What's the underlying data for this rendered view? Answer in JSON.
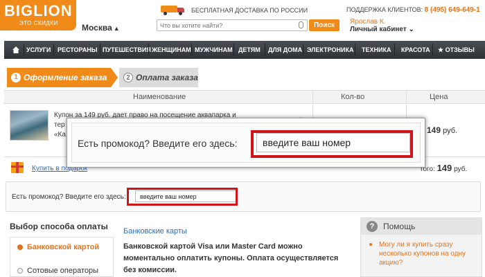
{
  "header": {
    "logo_title": "BIGLION",
    "logo_sub": "ЭТО СКИДКИ",
    "city": "Москва",
    "delivery": "БЕСПЛАТНАЯ ДОСТАВКА ПО РОССИИ",
    "search_placeholder": "Что вы хотите найти?",
    "search_button": "Поиск",
    "support_label": "ПОДДЕРЖКА КЛИЕНТОВ:",
    "support_phone": "8 (495) 649-649-1",
    "user_name": "Ярослав К.",
    "cabinet": "Личный кабинет"
  },
  "nav": {
    "items": [
      "УСЛУГИ",
      "РЕСТОРАНЫ",
      "ПУТЕШЕСТВИЯ",
      "ЖЕНЩИНАМ",
      "МУЖЧИНАМ",
      "ДЕТЯМ",
      "ДЛЯ ДОМА",
      "ЭЛЕКТРОНИКА",
      "ТЕХНИКА",
      "КРАСОТА",
      "ОТЗЫВЫ"
    ]
  },
  "steps": {
    "step1_num": "1",
    "step1_label": "Оформление заказа",
    "step2_num": "2",
    "step2_label": "Оплата заказа"
  },
  "table": {
    "col_name": "Наименование",
    "col_qty": "Кол-во",
    "col_price": "Цена",
    "row": {
      "text_line1": "Купон за 149 руб. дает право на посещение аквапарка и",
      "text_line2": "тер",
      "text_line3": "«Ка",
      "price_value": "149",
      "price_unit": "руб."
    }
  },
  "cart": {
    "buy_gift": "Купить в подарок",
    "total_label": "того:",
    "total_value": "149",
    "total_unit": "руб."
  },
  "promo": {
    "label": "Есть промокод? Введите его здесь:",
    "input_value": "введите ваш номер"
  },
  "payment": {
    "title": "Выбор способа оплаты",
    "option_selected": "Банковской картой",
    "option_other": "Сотовые операторы",
    "bank_cards": "Банковские карты",
    "bank_desc": "Банковской картой Visa или Master Card можно моментально оплатить купоны. Оплата осуществляется без комиссии."
  },
  "help": {
    "icon": "?",
    "title": "Помощь",
    "question": "Могу ли я купить сразу несколько купонов на одну акцию?"
  },
  "colors": {
    "brand": "#f08a18",
    "highlight": "#d0141a",
    "link": "#2a6ebb",
    "nav_bg": "#2e3236"
  }
}
